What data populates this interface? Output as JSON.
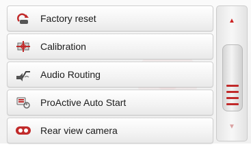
{
  "menu": {
    "items": [
      {
        "label": "Factory reset",
        "icon": "factory-reset-icon"
      },
      {
        "label": "Calibration",
        "icon": "calibration-icon"
      },
      {
        "label": "Audio Routing",
        "icon": "audio-routing-icon"
      },
      {
        "label": "ProActive Auto Start",
        "icon": "proactive-auto-start-icon"
      },
      {
        "label": "Rear view camera",
        "icon": "rear-view-camera-icon"
      }
    ]
  },
  "scroll": {
    "up_icon": "arrow-up-icon",
    "down_icon": "arrow-down-icon",
    "position_fraction": 0.8
  },
  "colors": {
    "accent": "#c12a2a",
    "item_text": "#1b1b1b"
  }
}
